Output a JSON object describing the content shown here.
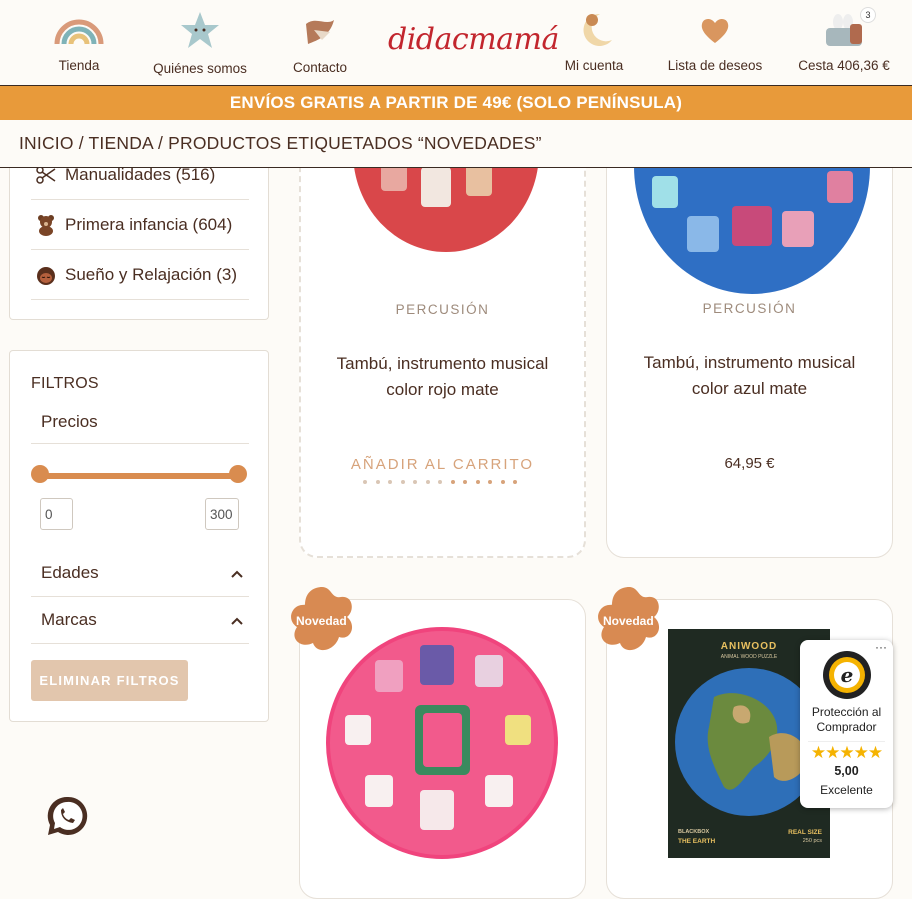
{
  "nav": {
    "tienda": "Tienda",
    "quienes": "Quiénes somos",
    "contacto": "Contacto",
    "logo": "didacmamá",
    "cuenta": "Mi cuenta",
    "deseos": "Lista de deseos",
    "cesta": "Cesta 406,36 €",
    "cart_count": "3"
  },
  "promo": "ENVÍOS GRATIS A PARTIR DE 49€ (SOLO PENÍNSULA)",
  "breadcrumb": "INICIO / TIENDA / PRODUCTOS ETIQUETADOS “NOVEDADES”",
  "sidebar": {
    "categories": [
      {
        "label": "Manualidades (516)",
        "icon": "scissors-icon"
      },
      {
        "label": "Primera infancia (604)",
        "icon": "teddy-bear-icon"
      },
      {
        "label": "Sueño y Relajación (3)",
        "icon": "sleeping-child-icon"
      }
    ],
    "filters_title": "FILTROS",
    "prices_label": "Precios",
    "price_min": "0",
    "price_max": "300",
    "ages_label": "Edades",
    "brands_label": "Marcas",
    "clear_button": "ELIMINAR FILTROS"
  },
  "products": [
    {
      "category": "PERCUSIÓN",
      "name_line1": "Tambú, instrumento musical",
      "name_line2": "color rojo mate",
      "action": "AÑADIR AL CARRITO",
      "color": "#d9474a"
    },
    {
      "category": "PERCUSIÓN",
      "name_line1": "Tambú, instrumento musical",
      "name_line2": "color azul mate",
      "price": "64,95 €",
      "color": "#2f6fc4"
    },
    {
      "badge": "Novedad",
      "color": "#f0447d"
    },
    {
      "badge": "Novedad",
      "puzzle_brand": "ANIWOOD",
      "puzzle_sub": "ANIMAL WOOD PUZZLE",
      "puzzle_left1": "BLACKBOX",
      "puzzle_left2": "THE EARTH",
      "puzzle_right1": "REAL SIZE",
      "puzzle_right2": "250 pcs"
    }
  ],
  "trusted_shops": {
    "line1": "Protección al",
    "line2": "Comprador",
    "stars": "★★★★★",
    "score": "5,00",
    "rating": "Excelente",
    "more": "···"
  },
  "colors": {
    "accent": "#e89a3a",
    "brown": "#4a2e22",
    "tan": "#d98c4f"
  }
}
